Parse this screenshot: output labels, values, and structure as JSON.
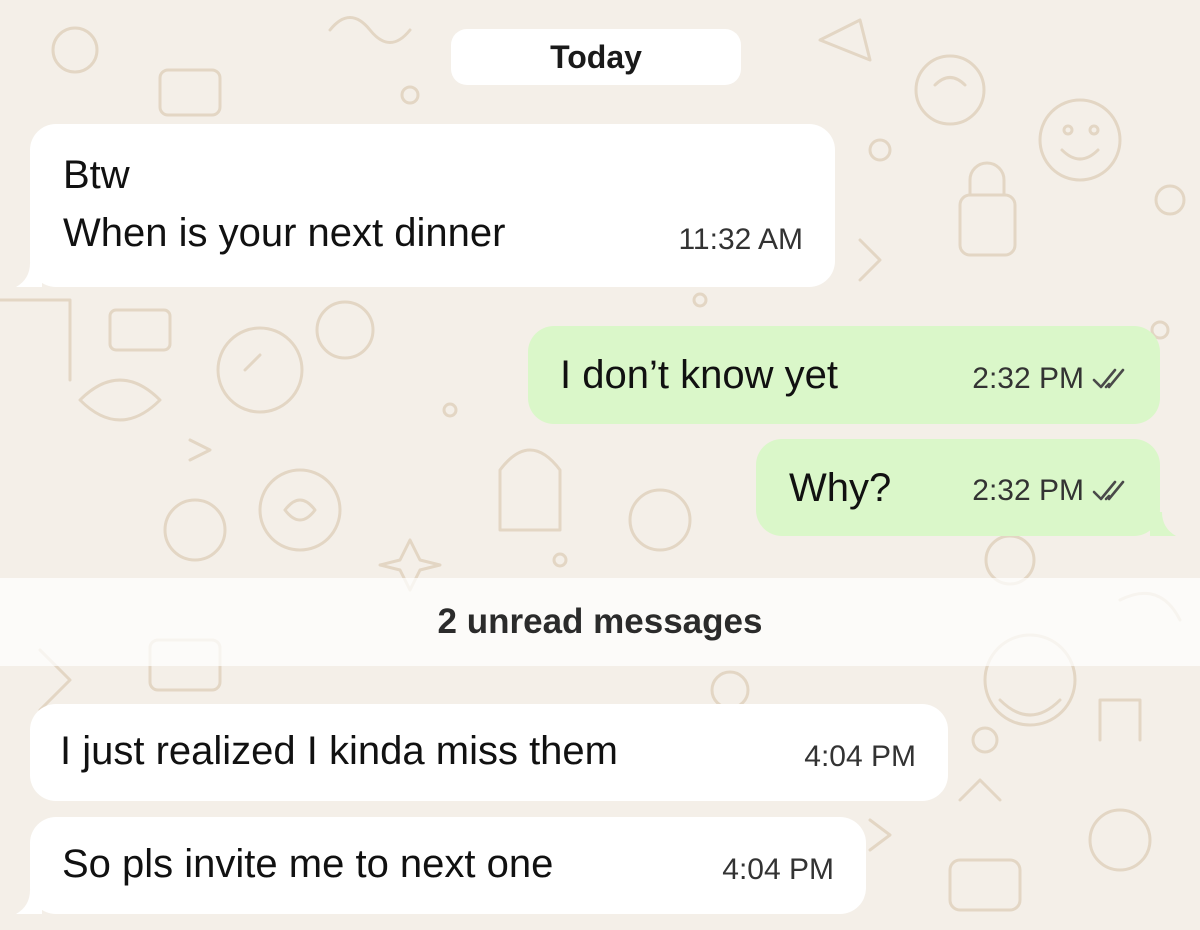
{
  "chat": {
    "date_divider": "Today",
    "unread_divider": "2 unread messages",
    "colors": {
      "wallpaper": "#f4efe8",
      "incoming_bubble": "#ffffff",
      "outgoing_bubble": "#daf7c9",
      "doodle": "#e5d8c6"
    },
    "messages": [
      {
        "direction": "incoming",
        "lines": [
          "Btw",
          "When is your next dinner"
        ],
        "time": "11:32 AM"
      },
      {
        "direction": "outgoing",
        "text": "I don’t know yet",
        "time": "2:32 PM",
        "status_icon": "double-check-icon"
      },
      {
        "direction": "outgoing",
        "text": "Why?",
        "time": "2:32 PM",
        "status_icon": "double-check-icon"
      },
      {
        "direction": "incoming",
        "text": "I just realized I kinda miss them",
        "time": "4:04 PM"
      },
      {
        "direction": "incoming",
        "text": "So pls invite me to next one",
        "time": "4:04 PM"
      }
    ]
  }
}
